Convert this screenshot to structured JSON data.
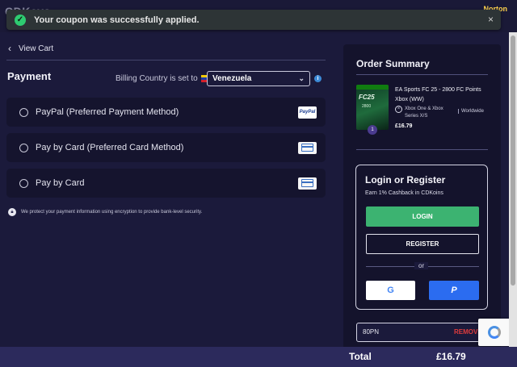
{
  "header": {
    "logo_text": "CDKeys",
    "norton_text": "Norton"
  },
  "toast": {
    "message": "Your coupon was successfully applied.",
    "close_glyph": "×",
    "check_glyph": "✓"
  },
  "nav": {
    "view_cart": "View Cart",
    "back_glyph": "‹"
  },
  "payment": {
    "title": "Payment",
    "billing_label": "Billing Country is set to",
    "country": "Venezuela",
    "dropdown_glyph": "⌄",
    "info_glyph": "i",
    "options": [
      {
        "label": "PayPal (Preferred Payment Method)",
        "badge": "PayPal",
        "icon": "paypal-icon"
      },
      {
        "label": "Pay by Card (Preferred Card Method)",
        "icon": "card-icon"
      },
      {
        "label": "Pay by Card",
        "icon": "card-icon"
      }
    ],
    "secure_note": "We protect your payment information using encryption to provide bank-level security."
  },
  "summary": {
    "title": "Order Summary",
    "product": {
      "name": "EA Sports FC 25 - 2800 FC Points Xbox (WW)",
      "platform": "Xbox One & Xbox Series X/S",
      "region": "Worldwide",
      "price": "£16.79",
      "quantity": "1"
    },
    "login": {
      "title": "Login or Register",
      "cashback": "Earn 1% Cashback in CDKoins",
      "login_label": "LOGIN",
      "register_label": "REGISTER",
      "or_label": "or",
      "google_glyph": "G",
      "paypal_glyph": "P"
    },
    "coupon": {
      "code": "80PN",
      "remove_label": "REMOVE"
    }
  },
  "totals": {
    "label": "Total",
    "value": "£16.79"
  },
  "colors": {
    "background": "#1b1a3b",
    "success": "#2ecc71",
    "login_green": "#3cb371",
    "paypal_blue": "#2b6cf0",
    "remove_red": "#e03c3c"
  }
}
